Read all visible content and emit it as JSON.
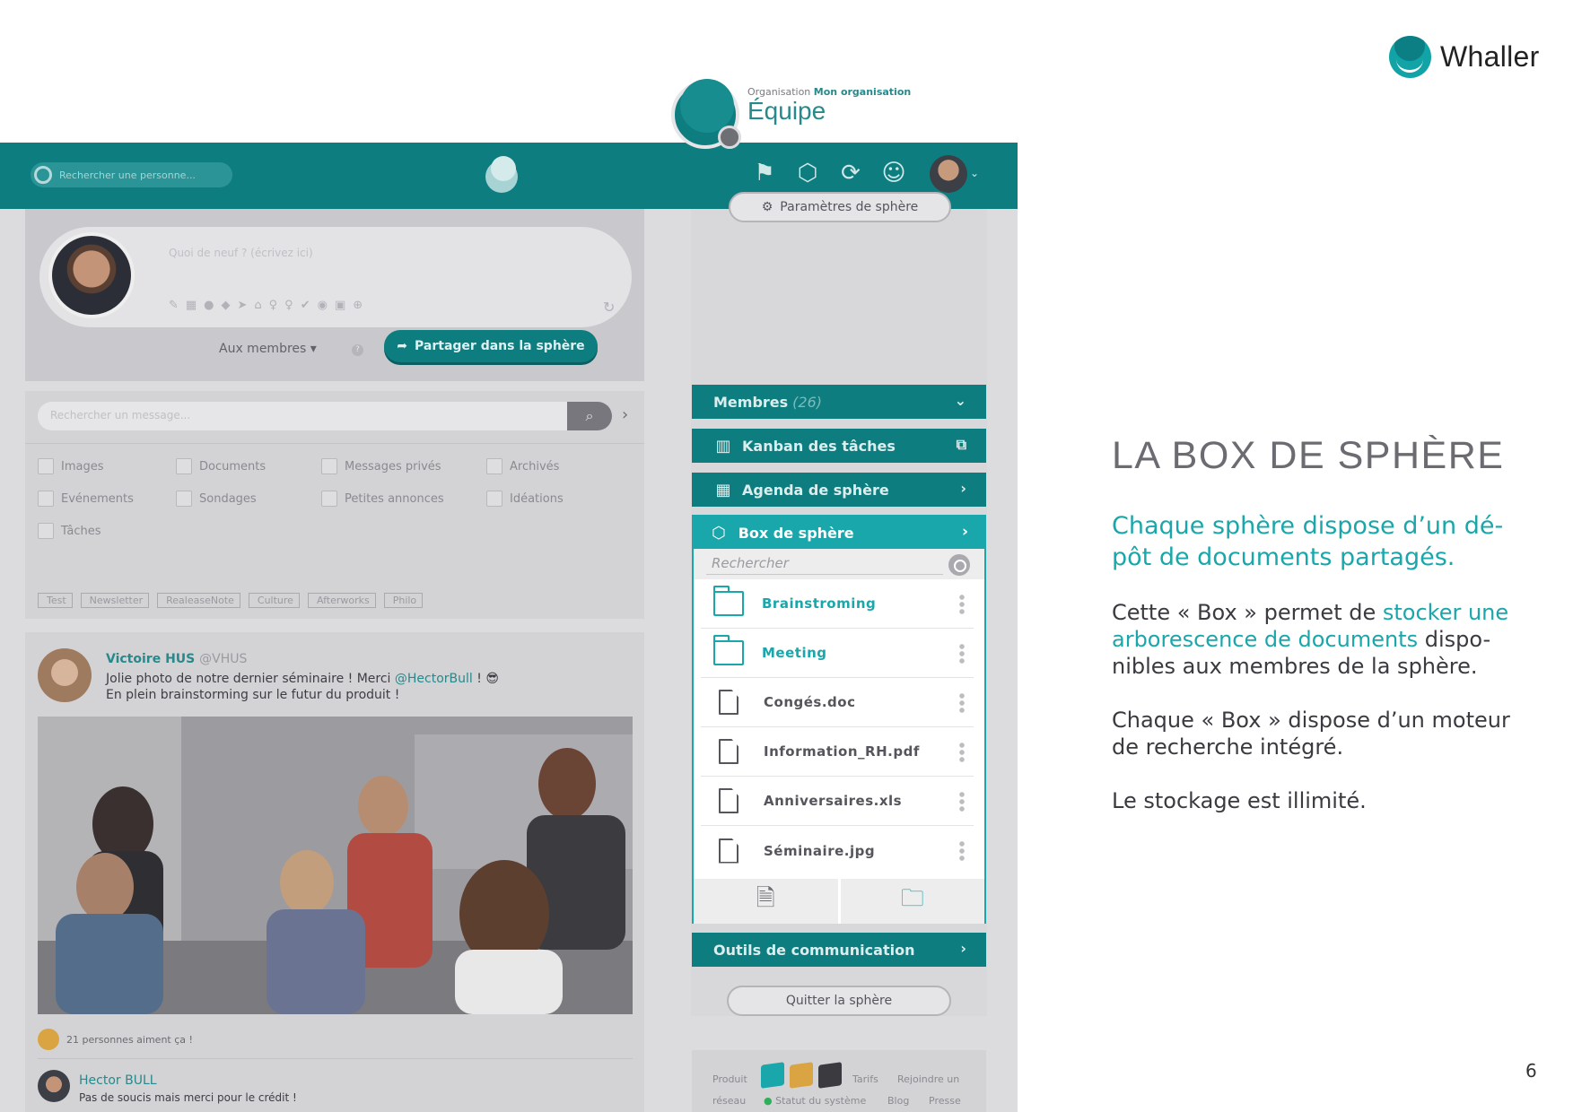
{
  "brand": {
    "name": "Whaller"
  },
  "app": {
    "search_person_placeholder": "Rechercher une personne...",
    "composer": {
      "placeholder": "Quoi de neuf ? (écrivez ici)",
      "audience": "Aux membres",
      "share_button": "Partager dans la sphère"
    },
    "filters": {
      "search_placeholder": "Rechercher un message...",
      "checkboxes": [
        "Images",
        "Documents",
        "Messages privés",
        "Archivés",
        "Evénements",
        "Sondages",
        "Petites annonces",
        "Idéations",
        "Tâches"
      ],
      "tags": [
        "Test",
        "Newsletter",
        "RealeaseNote",
        "Culture",
        "Afterworks",
        "Philo"
      ]
    },
    "post": {
      "author": "Victoire HUS",
      "handle": "@VHUS",
      "text_line1_a": "Jolie photo de notre dernier séminaire ! Merci",
      "mention": "@HectorBull",
      "text_line1_b": "! 😎",
      "text_line2": "En plein brainstorming sur le futur du produit !",
      "likes": "21 personnes aiment ça !",
      "reply_author": "Hector BULL",
      "reply_text": "Pas de soucis mais merci pour le crédit !"
    },
    "sphere": {
      "org_label": "Organisation",
      "org_name": "Mon organisation",
      "name": "Équipe",
      "params_button": "Paramètres de sphère",
      "sections": {
        "members": "Membres",
        "members_count": "(26)",
        "kanban": "Kanban des tâches",
        "agenda": "Agenda de sphère",
        "box": "Box de sphère",
        "tools": "Outils de communication"
      },
      "box_search_placeholder": "Rechercher",
      "files": [
        {
          "name": "Brainstroming",
          "type": "folder"
        },
        {
          "name": "Meeting",
          "type": "folder"
        },
        {
          "name": "Congés.doc",
          "type": "file"
        },
        {
          "name": "Information_RH.pdf",
          "type": "file"
        },
        {
          "name": "Anniversaires.xls",
          "type": "file"
        },
        {
          "name": "Séminaire.jpg",
          "type": "file"
        }
      ],
      "quit_button": "Quitter la sphère",
      "footer": {
        "produit": "Produit",
        "tarifs": "Tarifs",
        "rejoindre": "Rejoindre un",
        "reseau": "réseau",
        "statut": "Statut du système",
        "blog": "Blog",
        "presse": "Presse"
      }
    }
  },
  "slide": {
    "title": "LA BOX DE SPHÈRE",
    "lead": "Chaque sphère dispose d’un dé-pôt de documents partagés.",
    "para1_a": "Cette « Box » permet de ",
    "para1_hl": "stocker une arborescence de documents",
    "para1_b": " dispo-nibles aux membres de la sphère.",
    "para2": "Chaque « Box » dispose d’un moteur de recherche intégré.",
    "para3": "Le stockage est illimité.",
    "page_number": "6"
  },
  "colors": {
    "teal_dark": "#0e7d80",
    "teal": "#19a7ab",
    "text": "#3a3a40"
  },
  "icons": [
    "flag-icon",
    "add-sphere-icon",
    "add-network-icon",
    "add-contact-icon",
    "search-icon",
    "gear-icon",
    "chevron-down-icon",
    "chevron-right-icon",
    "external-link-icon",
    "calendar-icon",
    "box-icon",
    "folder-icon",
    "file-icon",
    "add-file-icon",
    "add-folder-icon"
  ]
}
